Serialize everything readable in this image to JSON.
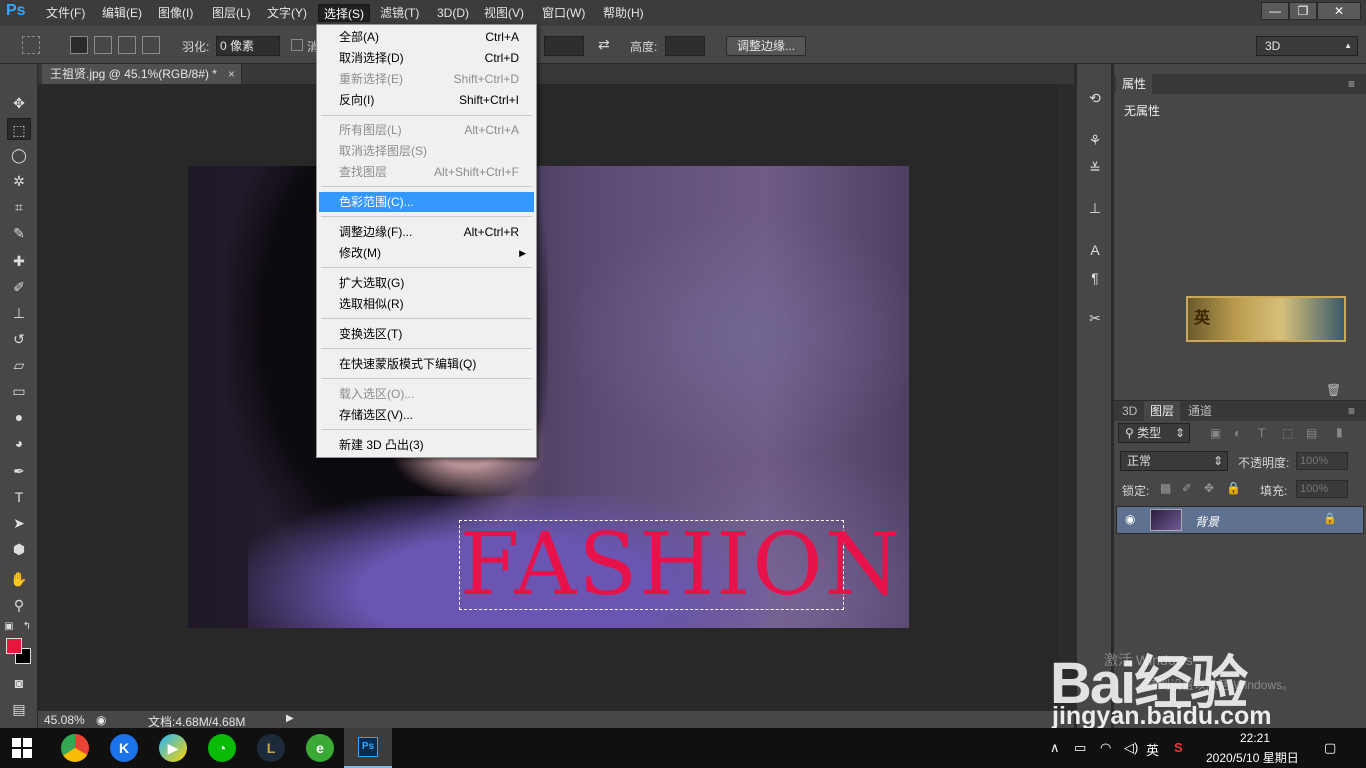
{
  "app": {
    "logo": "Ps",
    "menus": [
      "文件(F)",
      "编辑(E)",
      "图像(I)",
      "图层(L)",
      "文字(Y)",
      "选择(S)",
      "滤镜(T)",
      "3D(D)",
      "视图(V)",
      "窗口(W)",
      "帮助(H)"
    ],
    "window_controls": [
      "—",
      "❐",
      "✕"
    ]
  },
  "options_bar": {
    "feather_label": "羽化:",
    "feather_value": "0 像素",
    "antialias_label": "消",
    "height_label": "高度:",
    "refine_edge_button": "调整边缘...",
    "workspace": "3D"
  },
  "document": {
    "tab_title": "王祖贤.jpg @ 45.1%(RGB/8#) *",
    "tab_close": "×",
    "canvas_text": "FASHION"
  },
  "status_bar": {
    "zoom": "45.08%",
    "doc_info": "文档:4.68M/4.68M"
  },
  "select_menu": {
    "items": [
      {
        "label": "全部(A)",
        "shortcut": "Ctrl+A"
      },
      {
        "label": "取消选择(D)",
        "shortcut": "Ctrl+D"
      },
      {
        "label": "重新选择(E)",
        "shortcut": "Shift+Ctrl+D"
      },
      {
        "label": "反向(I)",
        "shortcut": "Shift+Ctrl+I"
      },
      {
        "label": "所有图层(L)",
        "shortcut": "Alt+Ctrl+A"
      },
      {
        "label": "取消选择图层(S)",
        "shortcut": ""
      },
      {
        "label": "查找图层",
        "shortcut": "Alt+Shift+Ctrl+F"
      },
      {
        "label": "色彩范围(C)...",
        "shortcut": ""
      },
      {
        "label": "调整边缘(F)...",
        "shortcut": "Alt+Ctrl+R"
      },
      {
        "label": "修改(M)",
        "shortcut": ""
      },
      {
        "label": "扩大选取(G)",
        "shortcut": ""
      },
      {
        "label": "选取相似(R)",
        "shortcut": ""
      },
      {
        "label": "变换选区(T)",
        "shortcut": ""
      },
      {
        "label": "在快速蒙版模式下编辑(Q)",
        "shortcut": ""
      },
      {
        "label": "载入选区(O)...",
        "shortcut": ""
      },
      {
        "label": "存储选区(V)...",
        "shortcut": ""
      },
      {
        "label": "新建 3D 凸出(3)",
        "shortcut": ""
      }
    ]
  },
  "properties_panel": {
    "tab": "属性",
    "content": "无属性",
    "thumbnail_text": "英"
  },
  "layers_panel": {
    "tabs": [
      "3D",
      "图层",
      "通道"
    ],
    "filter_kind": "类型",
    "blend_mode": "正常",
    "opacity_label": "不透明度:",
    "opacity_value": "100%",
    "lock_label": "锁定:",
    "fill_label": "填充:",
    "fill_value": "100%",
    "layer_name": "背景"
  },
  "watermark": {
    "brand": "Bai经验",
    "url": "jingyan.baidu.com",
    "activate_line1": "激活 Windows",
    "activate_line2": "转到设置以激活 Windows。"
  },
  "taskbar": {
    "ime": "英",
    "time": "22:21",
    "date": "2020/5/10 星期日"
  }
}
